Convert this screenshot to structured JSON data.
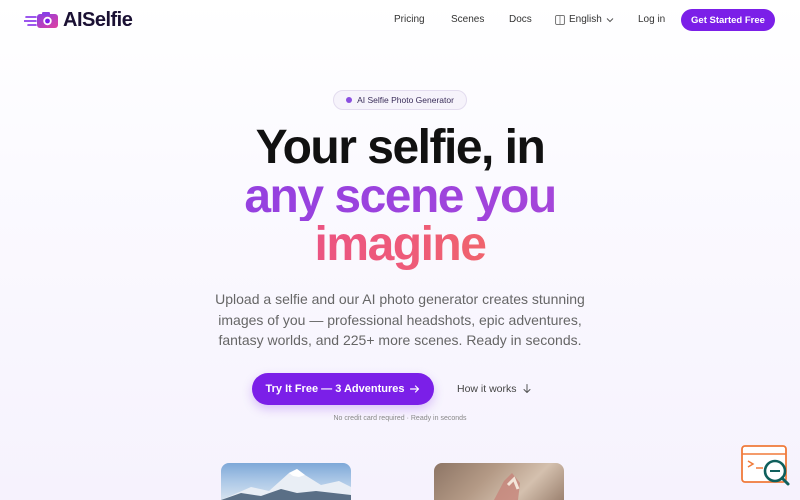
{
  "brand": {
    "name": "AISelfie"
  },
  "nav": {
    "links": [
      "Pricing",
      "Scenes",
      "Docs"
    ],
    "language": "English",
    "login": "Log in",
    "cta": "Get Started Free"
  },
  "hero": {
    "badge": "AI Selfie Photo Generator",
    "headline_line1": "Your selfie, in",
    "headline_line2": "any scene you",
    "headline_line3": "imagine",
    "subtext": "Upload a selfie and our AI photo generator creates stunning images of you — professional headshots, epic adventures, fantasy worlds, and 225+ more scenes. Ready in seconds.",
    "primary_cta": "Try It Free — 3 Adventures",
    "secondary_cta": "How it works",
    "note": "No credit card required · Ready in seconds"
  },
  "icons": {
    "logo": "camera-logo-icon",
    "language": "globe-icon",
    "language_toggle": "chevron-down-icon",
    "primary_cta": "arrow-right-icon",
    "secondary_cta": "arrow-down-icon",
    "corner_widget": "search-chat-icon"
  },
  "colors": {
    "accent": "#7b1fe8",
    "headline_purple": "#8e3fe1",
    "headline_gradient_start": "#e0409f",
    "headline_gradient_end": "#f6883e",
    "widget_orange": "#f07a3a"
  }
}
